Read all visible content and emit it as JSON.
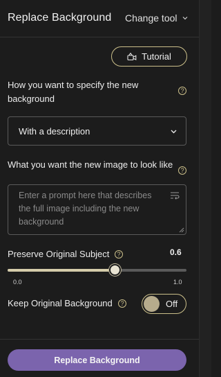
{
  "header": {
    "title": "Replace Background",
    "change_tool_label": "Change tool"
  },
  "tutorial": {
    "label": "Tutorial"
  },
  "specify": {
    "label": "How you want to specify the new background",
    "help": "?",
    "selected_option": "With a description"
  },
  "prompt": {
    "label": "What you want the new image to look like",
    "help": "?",
    "placeholder": "Enter a prompt here that describes the full image including the new background",
    "value": ""
  },
  "preserve": {
    "label": "Preserve Original Subject",
    "help": "?",
    "value": 0.6,
    "value_text": "0.6",
    "min_label": "0.0",
    "max_label": "1.0"
  },
  "keep_background": {
    "label": "Keep Original Background",
    "help": "?",
    "state": "Off"
  },
  "submit": {
    "label": "Replace Background"
  },
  "colors": {
    "accent": "#cbbf8a",
    "primary_button": "#7b64ad",
    "background": "#1c1c1c"
  },
  "icons": {
    "change_tool": "chevron-down-icon",
    "tutorial": "video-camera-icon",
    "help": "question-circle-icon",
    "select": "chevron-down-icon",
    "prompt_wrap": "text-wrap-icon"
  }
}
